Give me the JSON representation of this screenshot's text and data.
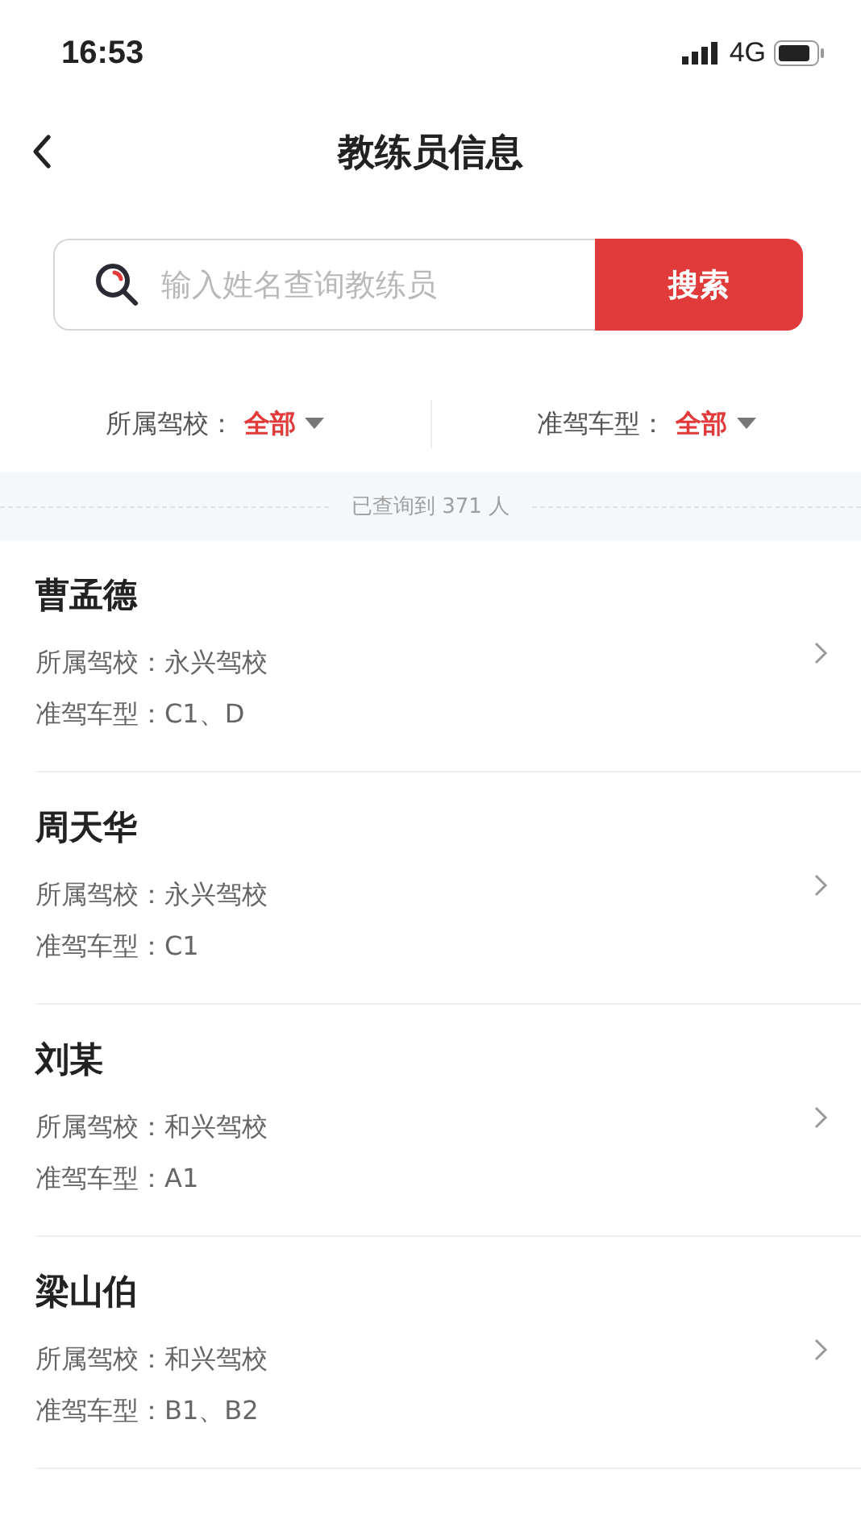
{
  "status_bar": {
    "time": "16:53",
    "network": "4G"
  },
  "header": {
    "title": "教练员信息"
  },
  "search": {
    "placeholder": "输入姓名查询教练员",
    "button": "搜索"
  },
  "filters": [
    {
      "label": "所属驾校：",
      "value": "全部"
    },
    {
      "label": "准驾车型：",
      "value": "全部"
    }
  ],
  "result_count": "已查询到 371 人",
  "coaches": [
    {
      "name": "曹孟德",
      "school": "所属驾校：永兴驾校",
      "license": "准驾车型：C1、D"
    },
    {
      "name": "周天华",
      "school": "所属驾校：永兴驾校",
      "license": "准驾车型：C1"
    },
    {
      "name": "刘某",
      "school": "所属驾校：和兴驾校",
      "license": "准驾车型：A1"
    },
    {
      "name": "梁山伯",
      "school": "所属驾校：和兴驾校",
      "license": "准驾车型：B1、B2"
    }
  ]
}
